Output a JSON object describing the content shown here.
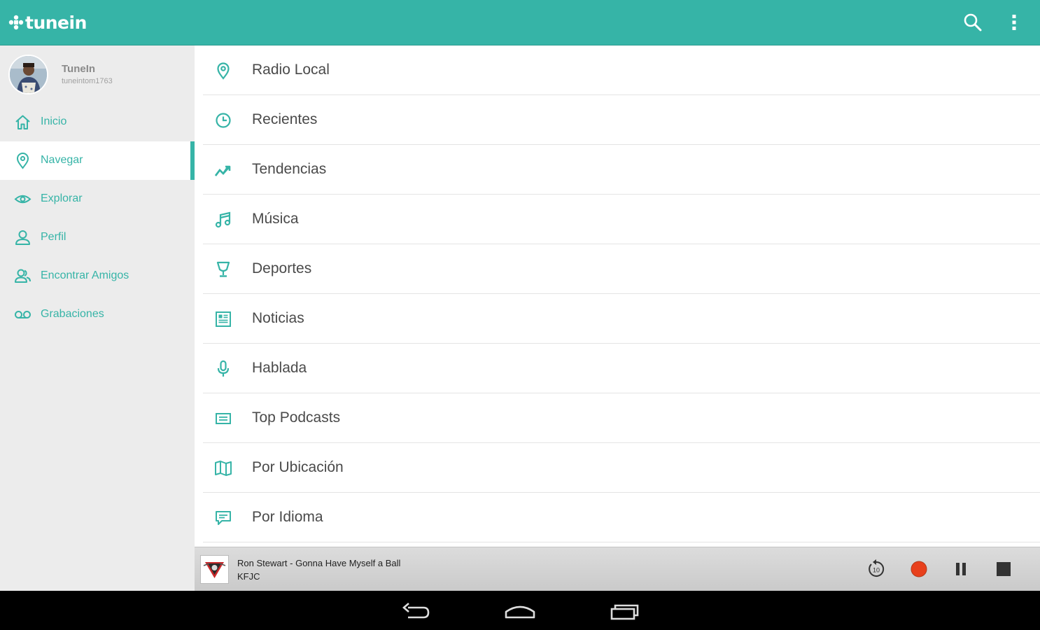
{
  "app": {
    "logo_text": "tunein",
    "brand_color": "#36b4a7",
    "top_icons": [
      "search-icon",
      "overflow-menu-icon"
    ]
  },
  "profile": {
    "name": "TuneIn",
    "username": "tuneintom1763"
  },
  "sidebar": {
    "active_index": 1,
    "items": [
      {
        "label": "Inicio",
        "icon": "home-icon"
      },
      {
        "label": "Navegar",
        "icon": "location-pin-icon"
      },
      {
        "label": "Explorar",
        "icon": "eye-icon"
      },
      {
        "label": "Perfil",
        "icon": "person-icon"
      },
      {
        "label": "Encontrar Amigos",
        "icon": "friends-icon"
      },
      {
        "label": "Grabaciones",
        "icon": "voicemail-icon"
      }
    ]
  },
  "browse": {
    "items": [
      {
        "label": "Radio Local",
        "icon": "location-pin-icon"
      },
      {
        "label": "Recientes",
        "icon": "clock-icon"
      },
      {
        "label": "Tendencias",
        "icon": "trending-icon"
      },
      {
        "label": "Música",
        "icon": "music-note-icon"
      },
      {
        "label": "Deportes",
        "icon": "trophy-icon"
      },
      {
        "label": "Noticias",
        "icon": "newspaper-icon"
      },
      {
        "label": "Hablada",
        "icon": "microphone-icon"
      },
      {
        "label": "Top Podcasts",
        "icon": "podcast-list-icon"
      },
      {
        "label": "Por Ubicación",
        "icon": "map-icon"
      },
      {
        "label": "Por Idioma",
        "icon": "speech-bubble-icon"
      }
    ]
  },
  "player": {
    "track": "Ron Stewart - Gonna Have Myself a Ball",
    "station": "KFJC",
    "rewind_seconds": "10",
    "record_color": "#e8401c",
    "controls": [
      "rewind-10-icon",
      "record-icon",
      "pause-icon",
      "stop-icon"
    ]
  },
  "system_nav": [
    "back-icon",
    "home-icon",
    "recents-icon"
  ]
}
